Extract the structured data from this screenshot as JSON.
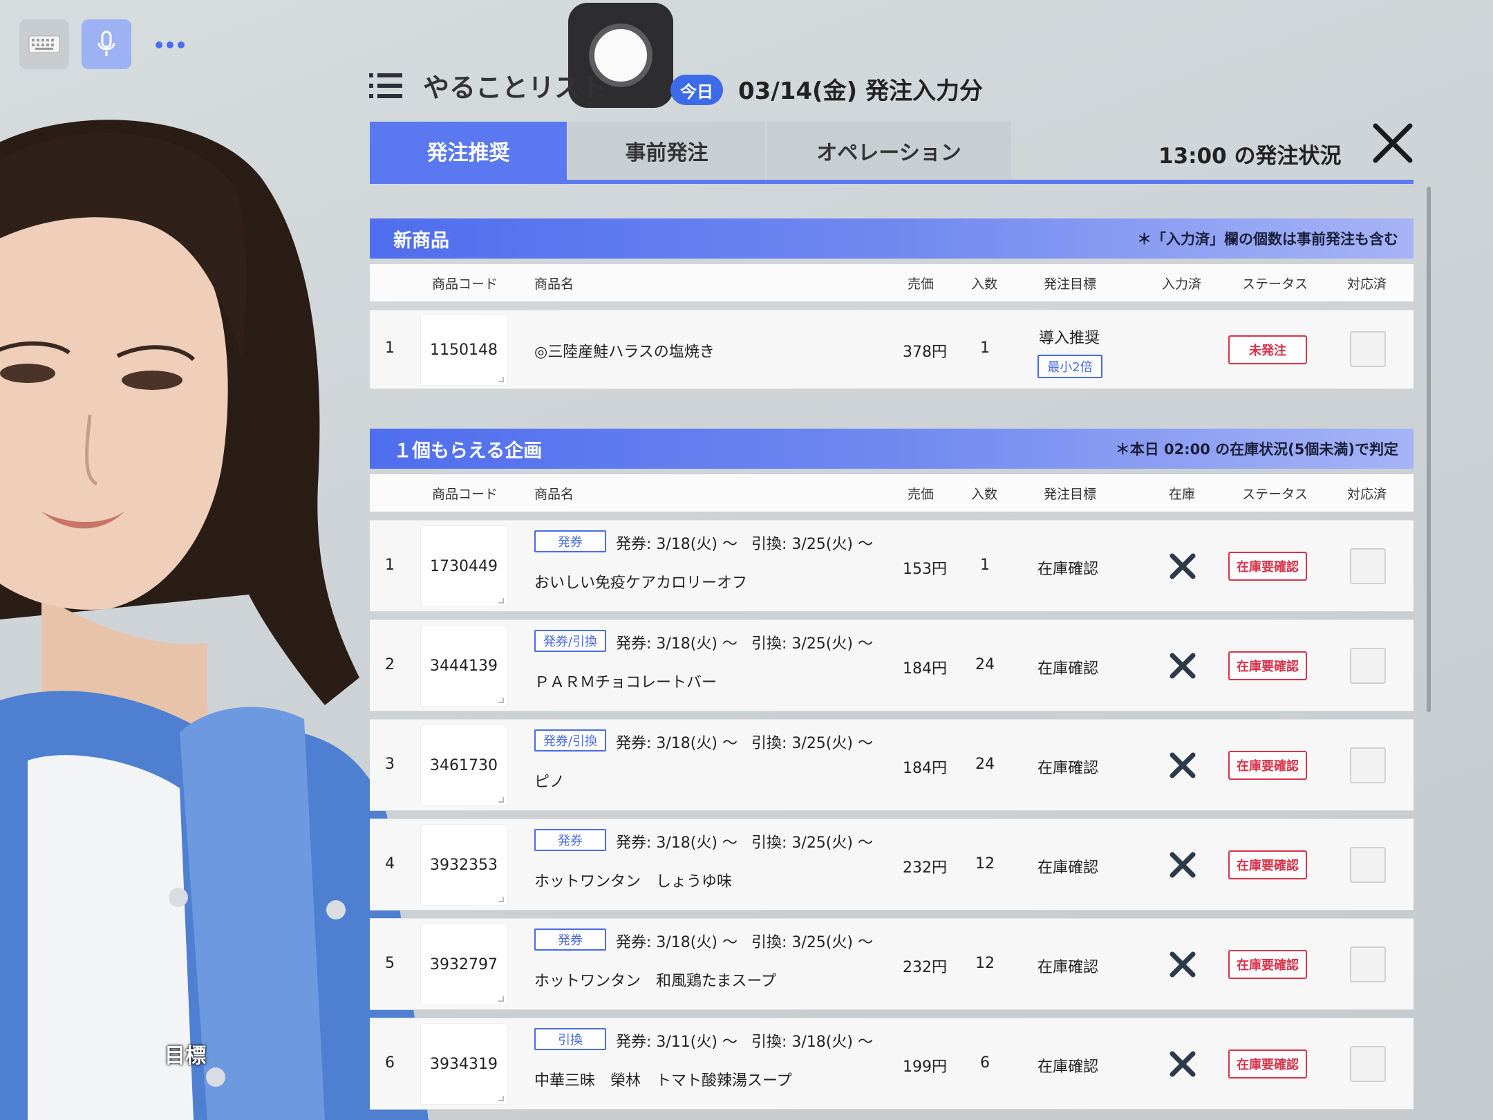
{
  "toolbar": {
    "keyboard_icon": "keyboard-icon",
    "mic_icon": "microphone-icon",
    "more_icon": "more-dots-icon"
  },
  "header": {
    "title": "やることリスト",
    "today_badge": "今日",
    "date_text": "03/14(金) 発注入力分"
  },
  "tabs": [
    {
      "label": "発注推奨",
      "active": true
    },
    {
      "label": "事前発注",
      "active": false
    },
    {
      "label": "オペレーション",
      "active": false
    }
  ],
  "status_time": "13:00 の発注状況",
  "columns": {
    "code": "商品コード",
    "name": "商品名",
    "price": "売価",
    "qty": "入数",
    "target": "発注目標",
    "entered": "入力済",
    "stock": "在庫",
    "status": "ステータス",
    "done": "対応済"
  },
  "section_new": {
    "title": "新商品",
    "note": "＊「入力済」欄の個数は事前発注も含む",
    "rows": [
      {
        "no": "1",
        "code": "1150148",
        "name": "◎三陸産鮭ハラスの塩焼き",
        "price": "378円",
        "qty": "1",
        "target": "導入推奨",
        "target_tag": "最小2倍",
        "status": "未発注"
      }
    ]
  },
  "section_campaign": {
    "title": "１個もらえる企画",
    "note": "＊本日 02:00 の在庫状況(5個未満)で判定",
    "rows": [
      {
        "no": "1",
        "code": "1730449",
        "tag": "発券",
        "issue": "発券: 3/18(火) 〜",
        "exchange": "引換: 3/25(火) 〜",
        "name": "おいしい免疫ケアカロリーオフ",
        "price": "153円",
        "qty": "1",
        "target": "在庫確認",
        "status": "在庫要確認"
      },
      {
        "no": "2",
        "code": "3444139",
        "tag": "発券/引換",
        "issue": "発券: 3/18(火) 〜",
        "exchange": "引換: 3/25(火) 〜",
        "name": "ＰＡＲＭチョコレートバー",
        "price": "184円",
        "qty": "24",
        "target": "在庫確認",
        "status": "在庫要確認"
      },
      {
        "no": "3",
        "code": "3461730",
        "tag": "発券/引換",
        "issue": "発券: 3/18(火) 〜",
        "exchange": "引換: 3/25(火) 〜",
        "name": "ピノ",
        "price": "184円",
        "qty": "24",
        "target": "在庫確認",
        "status": "在庫要確認"
      },
      {
        "no": "4",
        "code": "3932353",
        "tag": "発券",
        "issue": "発券: 3/18(火) 〜",
        "exchange": "引換: 3/25(火) 〜",
        "name": "ホットワンタン　しょうゆ味",
        "price": "232円",
        "qty": "12",
        "target": "在庫確認",
        "status": "在庫要確認"
      },
      {
        "no": "5",
        "code": "3932797",
        "tag": "発券",
        "issue": "発券: 3/18(火) 〜",
        "exchange": "引換: 3/25(火) 〜",
        "name": "ホットワンタン　和風鶏たまスープ",
        "price": "232円",
        "qty": "12",
        "target": "在庫確認",
        "status": "在庫要確認"
      },
      {
        "no": "6",
        "code": "3934319",
        "tag": "引換",
        "issue": "発券: 3/11(火) 〜",
        "exchange": "引換: 3/18(火) 〜",
        "name": "中華三昧　榮林　トマト酸辣湯スープ",
        "price": "199円",
        "qty": "6",
        "target": "在庫確認",
        "status": "在庫要確認"
      }
    ]
  },
  "avatar_caption": "目標"
}
